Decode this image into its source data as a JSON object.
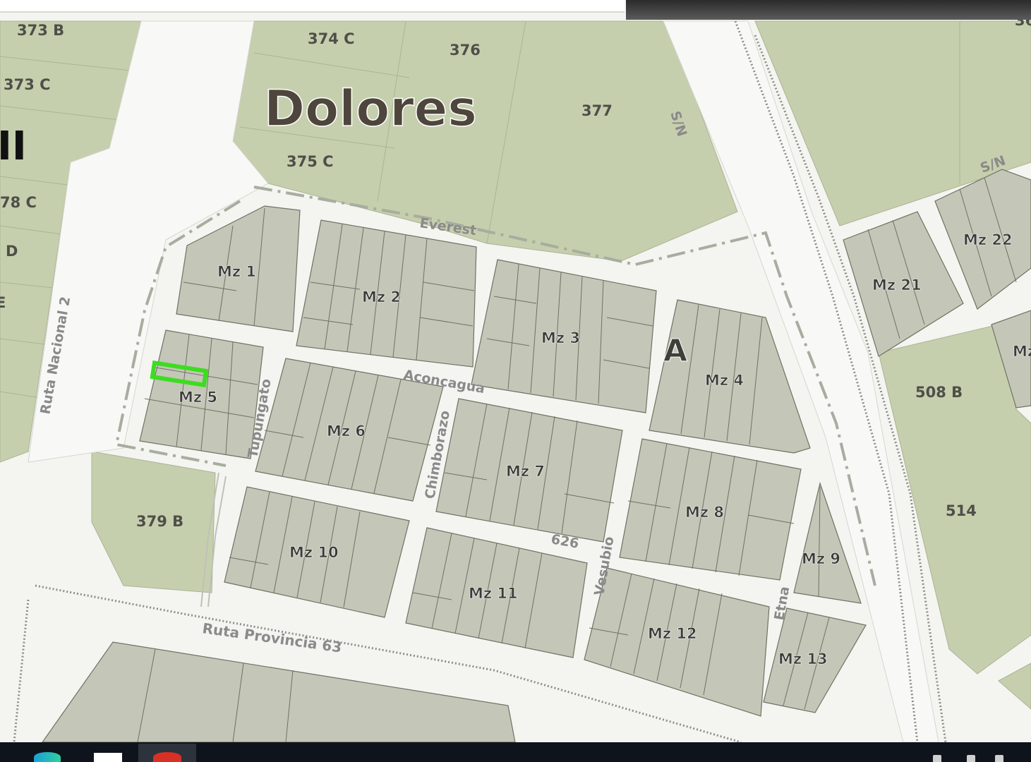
{
  "colors": {
    "background": "#f4f4f1",
    "parcel_fill": "#c6cfad",
    "block_fill": "#c4c6b8",
    "lot_line": "#6f7262",
    "block_label": "#3b3b38",
    "locality_label": "#4e463c",
    "street_label": "#8a8a8a",
    "highlight": "#3ddc21",
    "boundary_dash": "#a7ad9f"
  },
  "map": {
    "locality_name": "Dolores",
    "zone_letter": "A",
    "partial_label_left": "II",
    "parcels": [
      "373 B",
      "373 C",
      "374 C",
      "376",
      "377",
      "375 C",
      "78 C",
      "D",
      "E",
      "379 B",
      "508 B",
      "514"
    ],
    "parcel_label_partial_top_right": "36",
    "blocks": [
      "Mz 1",
      "Mz 2",
      "Mz 3",
      "Mz 4",
      "Mz 5",
      "Mz 6",
      "Mz 7",
      "Mz 8",
      "Mz 9",
      "Mz 10",
      "Mz 11",
      "Mz 12",
      "Mz 13",
      "Mz 21",
      "Mz 22",
      "Mz"
    ],
    "streets": {
      "everest": "Everest",
      "aconcagua": "Aconcagua",
      "tupungato": "Tupungato",
      "chimborazo": "Chimborazo",
      "vesubio": "Vesubio",
      "etna": "Etna",
      "s626": "626",
      "sn_1": "S/N",
      "sn_2": "S/N",
      "ruta_nacional": "Ruta Nacional 2",
      "ruta_provincial": "Ruta Provincia 63"
    },
    "highlighted_lot": "Mz 5"
  },
  "taskbar": {
    "icons": [
      "edge-icon",
      "file-explorer-icon",
      "chrome-icon"
    ]
  }
}
